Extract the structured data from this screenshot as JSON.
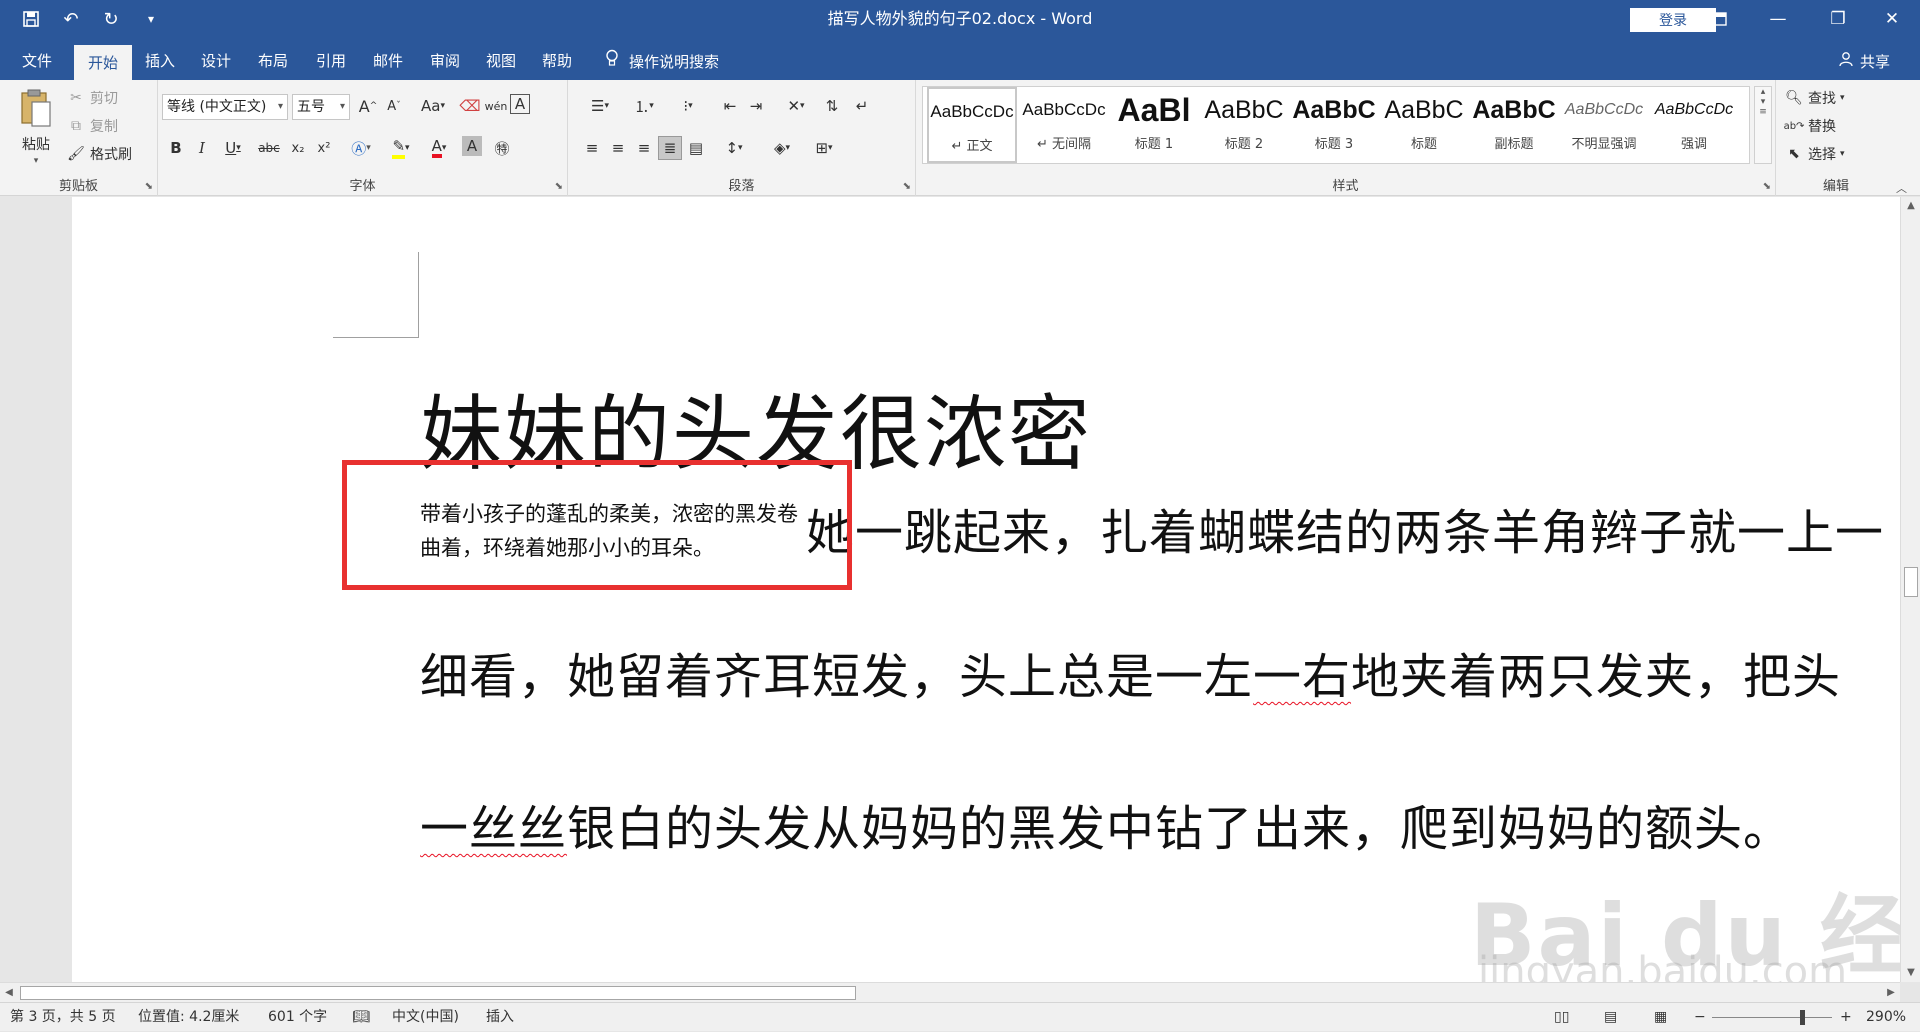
{
  "titlebar": {
    "doc_title": "描写人物外貌的句子02.docx  -  Word",
    "login_label": "登录",
    "qat_icons": [
      "save-icon",
      "undo-icon",
      "redo-icon",
      "customize-icon"
    ]
  },
  "tabs": [
    {
      "label": "文件"
    },
    {
      "label": "开始"
    },
    {
      "label": "插入"
    },
    {
      "label": "设计"
    },
    {
      "label": "布局"
    },
    {
      "label": "引用"
    },
    {
      "label": "邮件"
    },
    {
      "label": "审阅"
    },
    {
      "label": "视图"
    },
    {
      "label": "帮助"
    }
  ],
  "tellme": {
    "label": "操作说明搜索"
  },
  "share": {
    "label": "共享"
  },
  "clipboard": {
    "label": "剪贴板",
    "paste": "粘贴",
    "cut": "剪切",
    "copy": "复制",
    "format_painter": "格式刷"
  },
  "font": {
    "label": "字体",
    "font_name": "等线 (中文正文)",
    "font_size": "五号",
    "bold": "B",
    "italic": "I",
    "underline": "U",
    "strike": "abc",
    "subscript": "x₂",
    "superscript": "x²",
    "grow": "A",
    "shrink": "A",
    "case": "Aa",
    "color_a": "A",
    "shade_a": "A",
    "pinyin": "wén",
    "border_char": "A"
  },
  "paragraph": {
    "label": "段落"
  },
  "styles": {
    "label": "样式",
    "items": [
      {
        "sample": "AaBbCcDc",
        "name": "↵ 正文"
      },
      {
        "sample": "AaBbCcDc",
        "name": "↵ 无间隔"
      },
      {
        "sample": "AaBl",
        "name": "标题 1"
      },
      {
        "sample": "AaBbC",
        "name": "标题 2"
      },
      {
        "sample": "AaBbC",
        "name": "标题 3"
      },
      {
        "sample": "AaBbC",
        "name": "标题"
      },
      {
        "sample": "AaBbC",
        "name": "副标题"
      },
      {
        "sample": "AaBbCcDc",
        "name": "不明显强调"
      },
      {
        "sample": "AaBbCcDc",
        "name": "强调"
      }
    ]
  },
  "editing": {
    "label": "编辑",
    "find": "查找",
    "replace": "替换",
    "select": "选择"
  },
  "document": {
    "heading": "妹妹的头发很浓密",
    "small_text": "带着小孩子的蓬乱的柔美，浓密的黑发卷曲着，环绕着她那小小的耳朵。",
    "para1": "她一跳起来，扎着蝴蝶结的两条羊角辫子就一上一",
    "para2_a": "细看，她留着齐耳短发，头上总是一左",
    "para2_b": "一右",
    "para2_c": "地夹着两只发夹，把头",
    "para3_a": "一丝丝",
    "para3_b": "银白的头发从妈妈的黑发中钻了出来，爬到妈妈的额头。"
  },
  "watermark": {
    "logo": "Bai du 经验",
    "url": "jingyan.baidu.com"
  },
  "status": {
    "page": "第 3 页，共 5 页",
    "position": "位置值: 4.2厘米",
    "words": "601 个字",
    "language": "中文(中国)",
    "mode": "插入",
    "zoom": "290%",
    "zoom_minus": "−",
    "zoom_plus": "+"
  },
  "colors": {
    "accent": "#2b579a",
    "highlight_box": "#e8302f",
    "spell_error": "#e81123"
  }
}
